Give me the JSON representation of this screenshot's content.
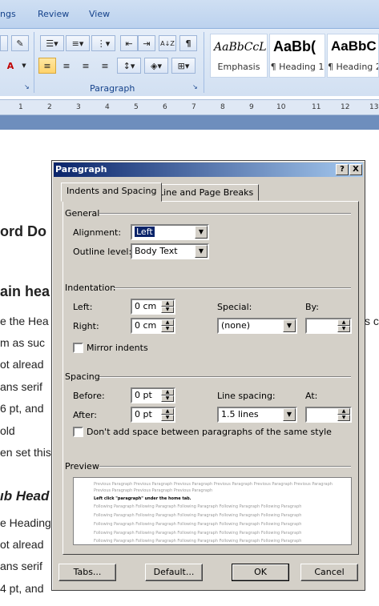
{
  "ribbon": {
    "tabs": [
      "ngs",
      "Review",
      "View"
    ],
    "group_label": "Paragraph",
    "styles": [
      {
        "sample": "AaBbCcL",
        "name": "Emphasis"
      },
      {
        "sample": "AaBb(",
        "name": "¶ Heading 1"
      },
      {
        "sample": "AaBbC",
        "name": "¶ Heading 2"
      }
    ],
    "icons": {
      "pilcrow": "¶",
      "font_color": "A",
      "sort": "A↓Z"
    }
  },
  "ruler": {
    "numbers": [
      "1",
      "2",
      "3",
      "4",
      "5",
      "6",
      "7",
      "8",
      "9",
      "10",
      "11",
      "12",
      "13"
    ]
  },
  "document": {
    "lines": [
      {
        "text": "ord Do",
        "cls": "doc-head"
      },
      {
        "text": "ain hea",
        "cls": "doc-head"
      },
      {
        "text": "e the Hea",
        "cls": ""
      },
      {
        "text": "m as suc",
        "cls": ""
      },
      {
        "text": "ot alread",
        "cls": ""
      },
      {
        "text": "ans serif",
        "cls": ""
      },
      {
        "text": "6 pt, and",
        "cls": ""
      },
      {
        "text": "old",
        "cls": ""
      },
      {
        "text": "en set this",
        "cls": ""
      },
      {
        "text": "ıb Head",
        "cls": "doc-head-i"
      },
      {
        "text": "e Heading",
        "cls": ""
      },
      {
        "text": "ot alread",
        "cls": ""
      },
      {
        "text": "ans serif",
        "cls": ""
      },
      {
        "text": "4 pt, and",
        "cls": ""
      }
    ],
    "right_fragment": "s c"
  },
  "dialog": {
    "title": "Paragraph",
    "help_button": "?",
    "close_button": "X",
    "tabs": [
      "Indents and Spacing",
      "Line and Page Breaks"
    ],
    "general": {
      "section": "General",
      "alignment_label": "Alignment:",
      "alignment_value": "Left",
      "outline_label": "Outline level:",
      "outline_value": "Body Text"
    },
    "indentation": {
      "section": "Indentation",
      "left_label": "Left:",
      "left_value": "0 cm",
      "right_label": "Right:",
      "right_value": "0 cm",
      "special_label": "Special:",
      "special_value": "(none)",
      "by_label": "By:",
      "by_value": "",
      "mirror_label": "Mirror indents"
    },
    "spacing": {
      "section": "Spacing",
      "before_label": "Before:",
      "before_value": "0 pt",
      "after_label": "After:",
      "after_value": "0 pt",
      "line_spacing_label": "Line spacing:",
      "line_spacing_value": "1.5 lines",
      "at_label": "At:",
      "at_value": "",
      "no_space_label": "Don't add space between paragraphs of the same style"
    },
    "preview": {
      "section": "Preview",
      "previous": "Previous Paragraph Previous Paragraph Previous Paragraph Previous Paragraph Previous Paragraph Previous Paragraph",
      "previous2": "Previous Paragraph Previous Paragraph Previous Paragraph",
      "current": "Left click \"paragraph\" under the home tab.",
      "following": "Following Paragraph Following Paragraph Following Paragraph Following Paragraph Following Paragraph"
    },
    "buttons": {
      "tabs": "Tabs...",
      "default": "Default...",
      "ok": "OK",
      "cancel": "Cancel"
    }
  }
}
